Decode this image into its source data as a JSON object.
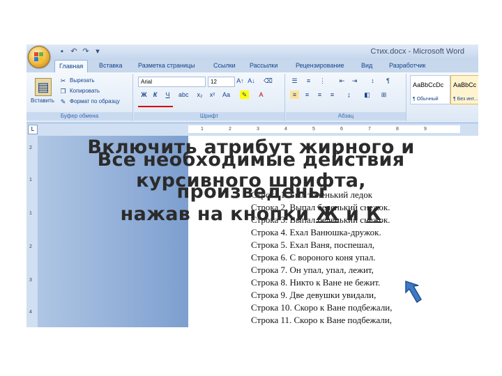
{
  "app": {
    "window_title": "Стих.docx - Microsoft Word"
  },
  "tabs": [
    "Главная",
    "Вставка",
    "Разметка страницы",
    "Ссылки",
    "Рассылки",
    "Рецензирование",
    "Вид",
    "Разработчик"
  ],
  "clipboard": {
    "paste": "Вставить",
    "cut": "Вырезать",
    "copy": "Копировать",
    "format_painter": "Формат по образцу",
    "label": "Буфер обмена"
  },
  "font": {
    "name": "Arial",
    "size": "12",
    "bold": "Ж",
    "italic": "К",
    "underline": "Ч",
    "label": "Шрифт"
  },
  "paragraph": {
    "label": "Абзац"
  },
  "styles": [
    {
      "sample": "АаBbCcDc",
      "name": "¶ Обычный"
    },
    {
      "sample": "АаBbCc",
      "name": "¶ Без инт..."
    }
  ],
  "document": {
    "lines": [
      "Строка 1. Был тоненький ледок",
      "Строка 2. Выпал беленький снежок.",
      "Строка 3. Выпал беленький снежок.",
      "Строка 4. Ехал Ванюшка-дружок.",
      "Строка 5. Ехал Ваня, поспешал,",
      "Строка 6. С вороного коня упал.",
      "Строка 7. Он упал, упал, лежит,",
      "Строка 8. Никто к Ване не бежит.",
      "Строка 9. Две девушки увидали,",
      "Строка 10. Скоро к Ване подбежали,",
      "Строка 11. Скоро к Ване подбежали,"
    ]
  },
  "overlay": {
    "text_a_line1": "Включить атрибут жирного и",
    "text_a_line2": "курсивного шрифта,",
    "text_a_line3_pre": "нажав на кнопки ",
    "text_a_bold": "Ж",
    "text_a_and": " и ",
    "text_a_italic": "К",
    "text_b_line1": "Все необходимые действия",
    "text_b_line2": "произведены"
  },
  "colors": {
    "accent": "#15428b",
    "highlight_marker": "#d40000",
    "arrow": "#3d7bc7"
  }
}
